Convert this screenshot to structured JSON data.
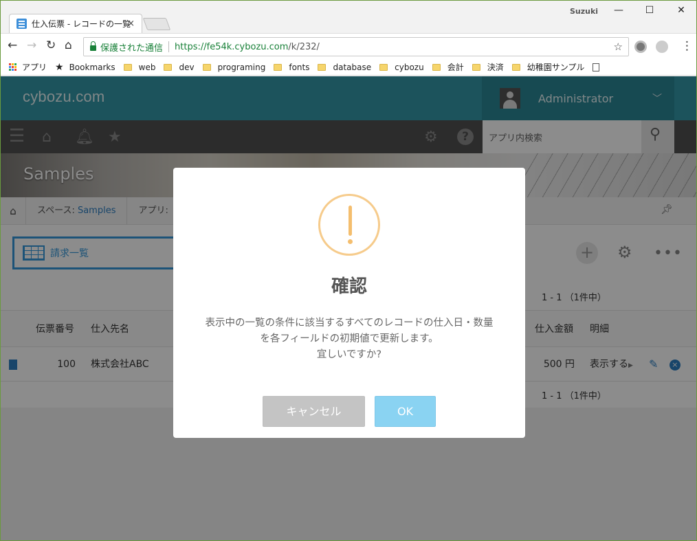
{
  "browser": {
    "tab_title": "仕入伝票 - レコードの一覧",
    "tab_close": "×",
    "user": "Suzuki",
    "window_controls": [
      "—",
      "☐",
      "✕"
    ],
    "security_label": "保護された通信",
    "url_host": "https://fe54k.cybozu.com",
    "url_path": "/k/232/",
    "bookmarks": [
      "アプリ",
      "Bookmarks",
      "web",
      "dev",
      "programing",
      "fonts",
      "database",
      "cybozu",
      "会計",
      "決済",
      "幼稚園サンプル"
    ]
  },
  "header": {
    "logo": "cybozu.com",
    "account_name": "Administrator",
    "search_placeholder": "アプリ内検索"
  },
  "banner": {
    "space_name": "Samples"
  },
  "breadcrumb": {
    "space_prefix": "スペース: ",
    "space_link": "Samples",
    "app_prefix": "アプリ: "
  },
  "view": {
    "name": "請求一覧"
  },
  "pager": {
    "top": "1 - 1 （1件中）",
    "bottom": "1 - 1 （1件中）"
  },
  "table": {
    "headers": [
      "伝票番号",
      "仕入先名",
      "仕入金額",
      "明細"
    ],
    "row": {
      "number": "100",
      "supplier": "株式会社ABC",
      "amount": "500 円",
      "detail": "表示する"
    }
  },
  "dialog": {
    "title": "確認",
    "message_line1": "表示中の一覧の条件に該当するすべてのレコードの仕入日・数量",
    "message_line2": "を各フィールドの初期値で更新します。",
    "message_line3": "宜しいですか?",
    "cancel_label": "キャンセル",
    "ok_label": "OK"
  }
}
